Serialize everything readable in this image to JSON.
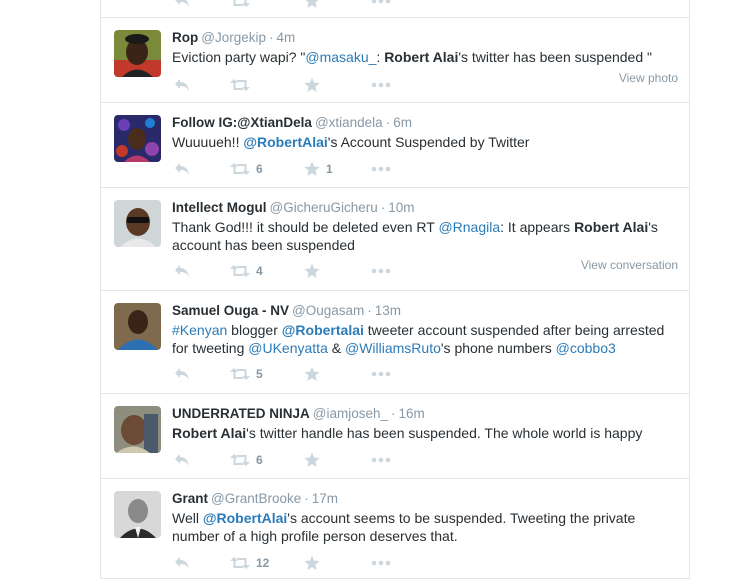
{
  "tweets": [
    {
      "fullname": "",
      "username": "",
      "time": "",
      "parts": [],
      "retweets": "",
      "favorites": "",
      "extra": ""
    },
    {
      "fullname": "Rop",
      "username": "@Jorgekip",
      "time": "4m",
      "parts": [
        {
          "t": "Eviction party wapi? \""
        },
        {
          "t": "@masaku_",
          "s": "link"
        },
        {
          "t": ": "
        },
        {
          "t": "Robert Alai",
          "s": "bold"
        },
        {
          "t": "'s twitter has been suspended \""
        }
      ],
      "retweets": "",
      "favorites": "",
      "extra": "View photo"
    },
    {
      "fullname": "Follow IG:@XtianDela",
      "username": "@xtiandela",
      "time": "6m",
      "parts": [
        {
          "t": "Wuuuueh!! "
        },
        {
          "t": "@RobertAlai",
          "s": "linkbold"
        },
        {
          "t": "'s Account Suspended by Twitter"
        }
      ],
      "retweets": "6",
      "favorites": "1",
      "extra": ""
    },
    {
      "fullname": "Intellect Mogul",
      "username": "@GicheruGicheru",
      "time": "10m",
      "parts": [
        {
          "t": "Thank God!!! it should be deleted even RT "
        },
        {
          "t": "@Rnagila",
          "s": "link"
        },
        {
          "t": ": It appears "
        },
        {
          "t": "Robert Alai",
          "s": "bold"
        },
        {
          "t": "'s account has been suspended"
        }
      ],
      "retweets": "4",
      "favorites": "",
      "extra": "View conversation"
    },
    {
      "fullname": "Samuel Ouga - NV",
      "username": "@Ougasam",
      "time": "13m",
      "parts": [
        {
          "t": "#Kenyan",
          "s": "link"
        },
        {
          "t": " blogger "
        },
        {
          "t": "@Robertalai",
          "s": "linkbold"
        },
        {
          "t": " tweeter account suspended after being arrested for tweeting "
        },
        {
          "t": "@UKenyatta",
          "s": "link"
        },
        {
          "t": " & "
        },
        {
          "t": "@WilliamsRuto",
          "s": "link"
        },
        {
          "t": "'s phone numbers "
        },
        {
          "t": "@cobbo3",
          "s": "link"
        }
      ],
      "retweets": "5",
      "favorites": "",
      "extra": ""
    },
    {
      "fullname": "UNDERRATED NINJA",
      "username": "@iamjoseh_",
      "time": "16m",
      "parts": [
        {
          "t": "Robert Alai",
          "s": "bold"
        },
        {
          "t": "'s twitter handle has been suspended. The whole world is happy"
        }
      ],
      "retweets": "6",
      "favorites": "",
      "extra": ""
    },
    {
      "fullname": "Grant",
      "username": "@GrantBrooke",
      "time": "17m",
      "parts": [
        {
          "t": "Well "
        },
        {
          "t": "@RobertAlai",
          "s": "linkbold"
        },
        {
          "t": "'s account seems to be suspended. Tweeting the private number of a high profile person deserves that."
        }
      ],
      "retweets": "12",
      "favorites": "",
      "extra": ""
    }
  ],
  "icons": {
    "reply": "reply-icon",
    "retweet": "retweet-icon",
    "favorite": "star-icon",
    "more": "more-dots-icon"
  },
  "colors": {
    "text": "#292f33",
    "muted": "#8899a6",
    "link": "#2b7bb9",
    "icon": "#ccd6dd",
    "border": "#e1e8ed"
  }
}
